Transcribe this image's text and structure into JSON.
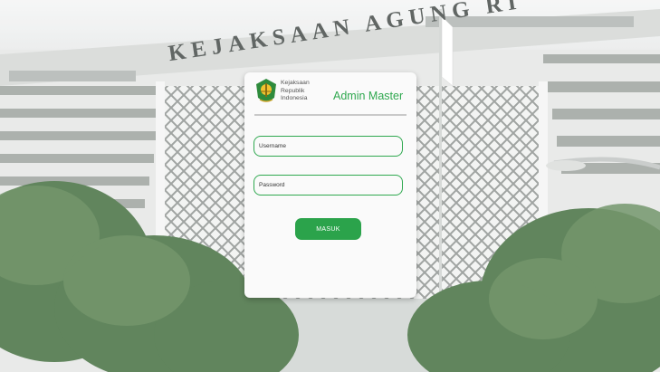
{
  "background": {
    "sign_text": "KEJAKSAAN AGUNG RI"
  },
  "login": {
    "brand_lines": [
      "Kejaksaan",
      "Republik",
      "Indonesia"
    ],
    "title": "Admin Master",
    "username_placeholder": "Username",
    "password_placeholder": "Password",
    "submit_label": "MASUK"
  },
  "colors": {
    "accent": "#2fa84f",
    "button": "#2ba34b",
    "card": "#fafafa"
  }
}
